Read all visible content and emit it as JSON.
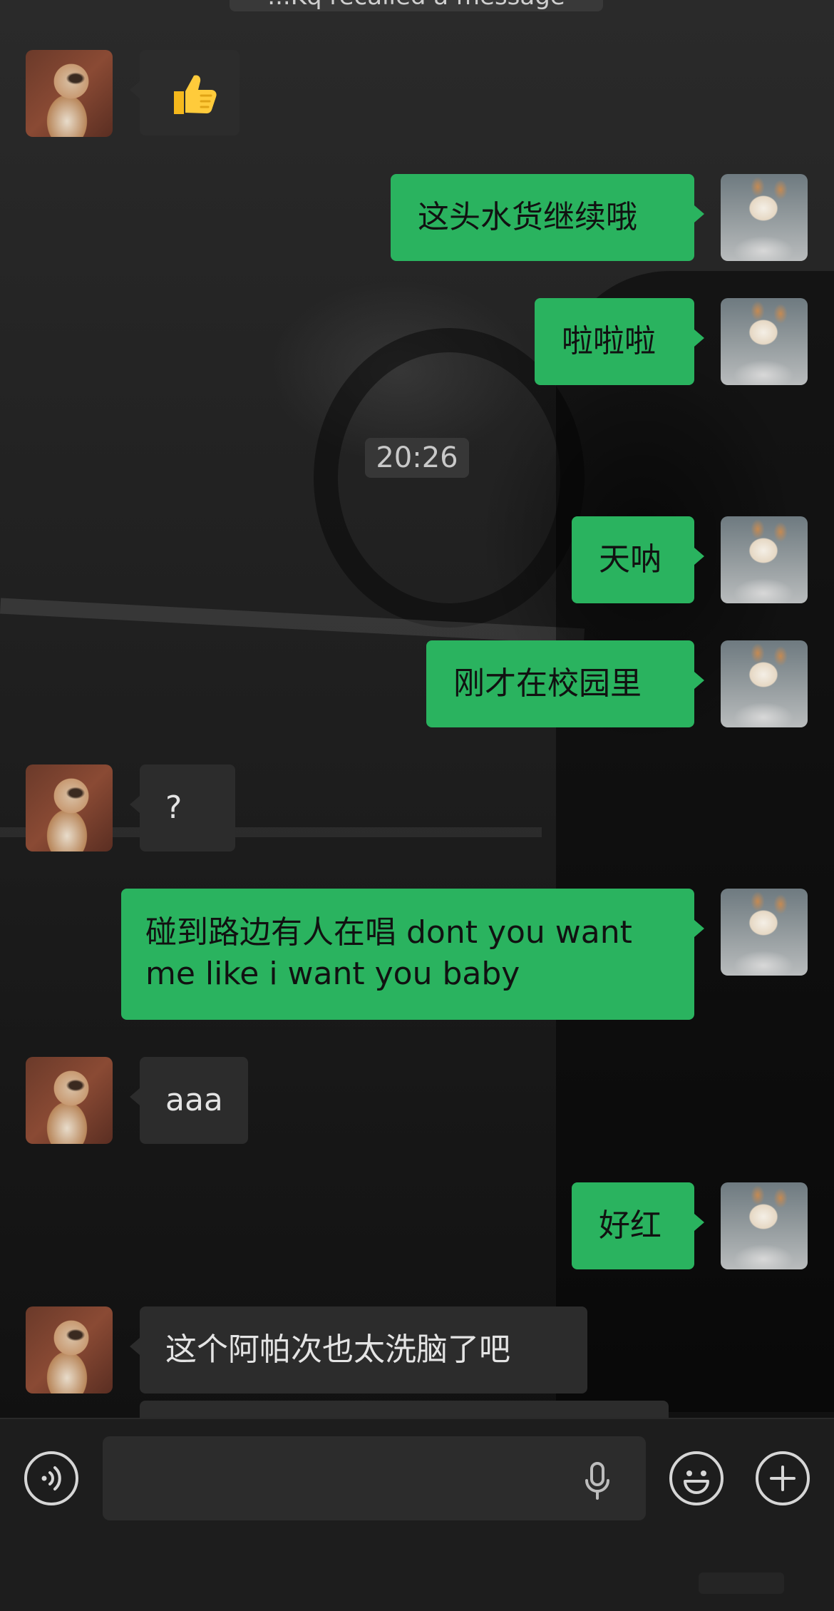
{
  "recall_notice": "...Kq recalled a message",
  "timestamp": "20:26",
  "messages": [
    {
      "id": "m1",
      "side": "in",
      "type": "emoji",
      "emoji": "thumbs-up",
      "text": "👍"
    },
    {
      "id": "m2",
      "side": "out",
      "text": "这头水货继续哦"
    },
    {
      "id": "m3",
      "side": "out",
      "text": "啦啦啦"
    },
    {
      "id": "m4",
      "side": "out",
      "text": "天呐"
    },
    {
      "id": "m5",
      "side": "out",
      "text": "刚才在校园里"
    },
    {
      "id": "m6",
      "side": "in",
      "text": "?"
    },
    {
      "id": "m7",
      "side": "out",
      "text": "碰到路边有人在唱 dont you want\nme like i want you baby"
    },
    {
      "id": "m8",
      "side": "in",
      "text": "aaa"
    },
    {
      "id": "m9",
      "side": "out",
      "text": "好红"
    },
    {
      "id": "m10",
      "side": "in",
      "text": "这个阿帕次也太洗脑了吧"
    }
  ],
  "input_bar": {
    "voice_button": "voice-icon",
    "text_field_value": "",
    "mic_icon": "microphone-icon",
    "emoji_button": "emoji-icon",
    "plus_button": "plus-icon"
  },
  "colors": {
    "outgoing_bubble": "#2ab35f",
    "incoming_bubble": "#2c2c2c",
    "input_bar": "#1d1d1d"
  }
}
